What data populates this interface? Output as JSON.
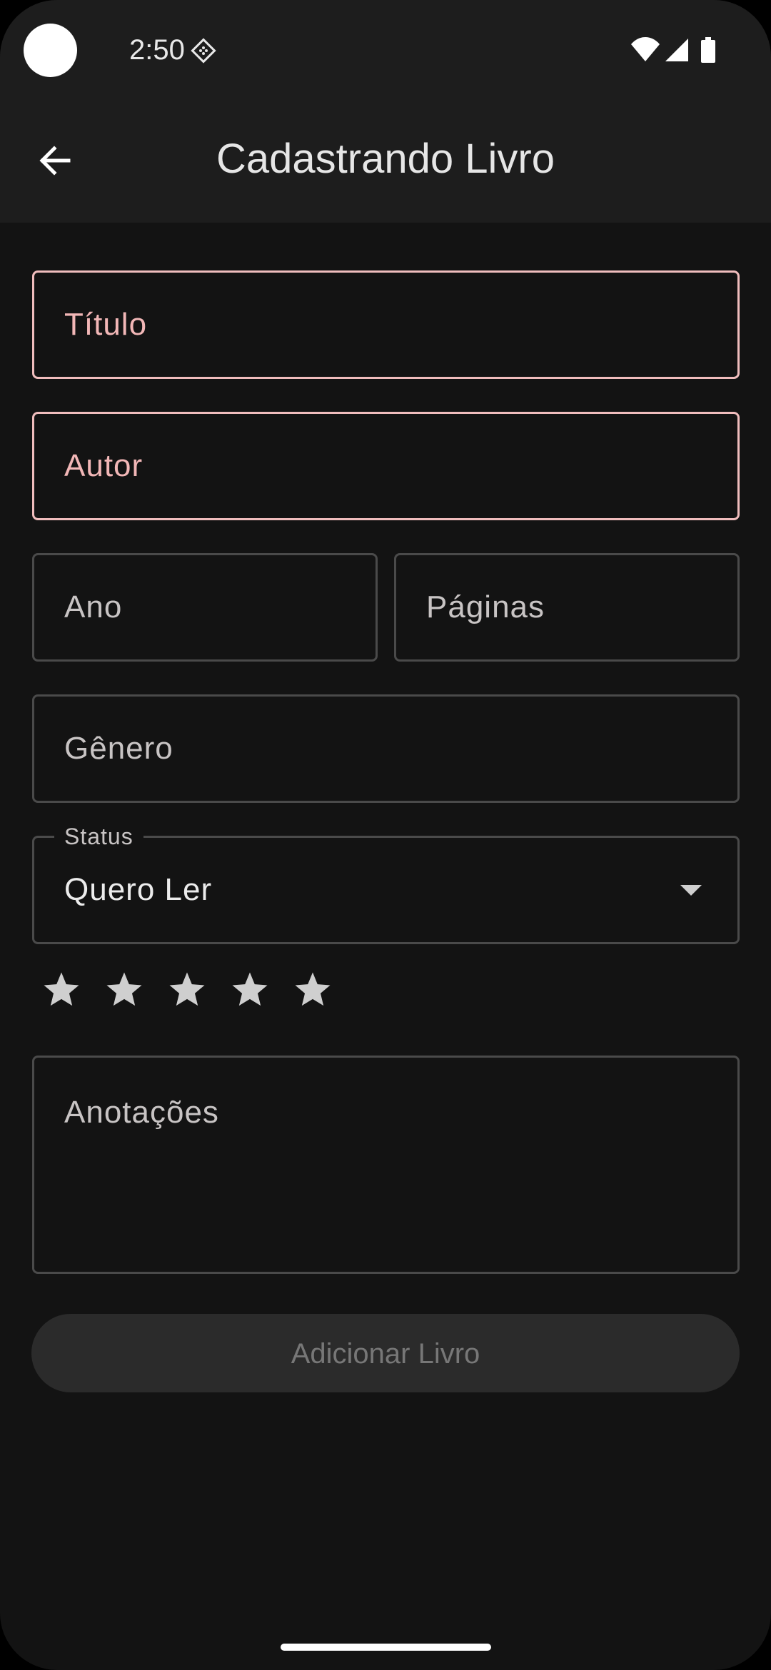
{
  "status_bar": {
    "time": "2:50",
    "icons": [
      "notification-app-icon",
      "wifi-icon",
      "cell-signal-icon",
      "battery-icon"
    ]
  },
  "app_bar": {
    "title": "Cadastrando Livro",
    "back_icon": "arrow-back-icon"
  },
  "form": {
    "titulo": {
      "label": "Título",
      "value": ""
    },
    "autor": {
      "label": "Autor",
      "value": ""
    },
    "ano": {
      "label": "Ano",
      "value": ""
    },
    "paginas": {
      "label": "Páginas",
      "value": ""
    },
    "genero": {
      "label": "Gênero",
      "value": ""
    },
    "status": {
      "label": "Status",
      "value": "Quero Ler"
    },
    "rating": {
      "max": 5,
      "value": 0
    },
    "anotacoes": {
      "label": "Anotações",
      "value": ""
    },
    "submit_label": "Adicionar Livro"
  },
  "colors": {
    "background": "#131313",
    "app_bar": "#1d1d1d",
    "error_outline": "#f0bdbd",
    "outline": "#4a4a4a",
    "disabled_button": "#2b2b2b",
    "star": "#cfcfcf"
  }
}
